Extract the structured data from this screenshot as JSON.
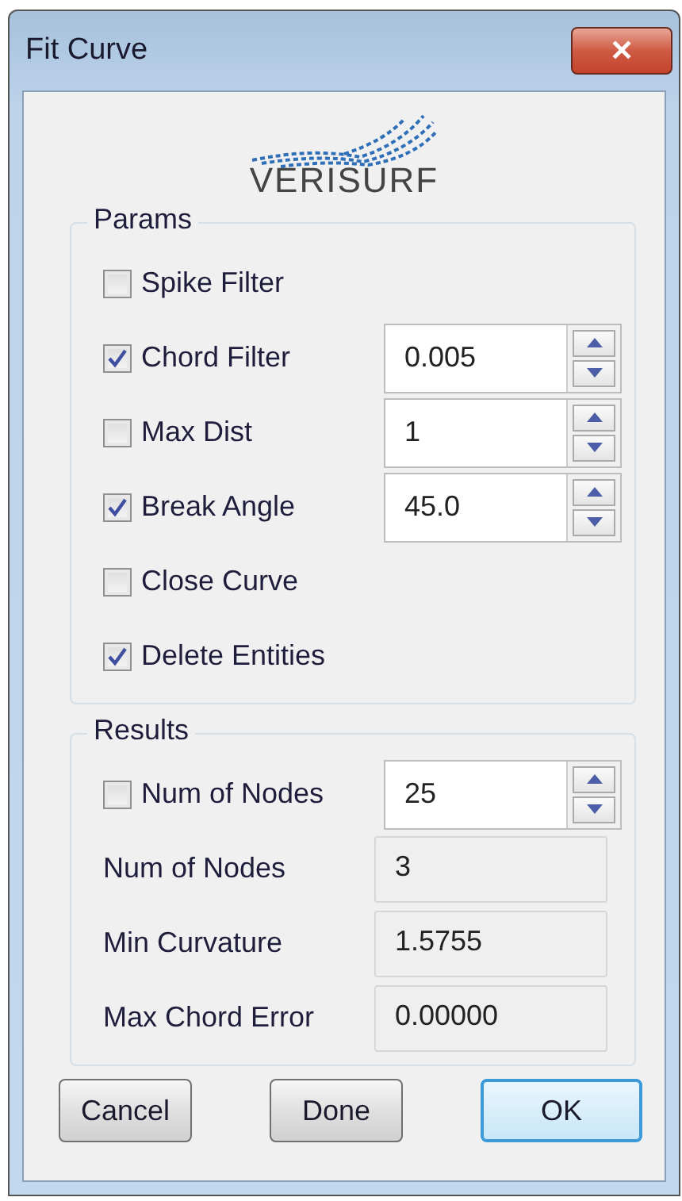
{
  "window": {
    "title": "Fit Curve",
    "close": "✕"
  },
  "logo": {
    "text": "VERISURF"
  },
  "params": {
    "title": "Params",
    "rows": [
      {
        "kind": "check",
        "label": "Spike Filter",
        "checked": false
      },
      {
        "kind": "spin",
        "label": "Chord Filter",
        "checked": true,
        "value": "0.005"
      },
      {
        "kind": "spin",
        "label": "Max Dist",
        "checked": false,
        "value": "1"
      },
      {
        "kind": "spin",
        "label": "Break Angle",
        "checked": true,
        "value": "45.0"
      },
      {
        "kind": "check",
        "label": "Close Curve",
        "checked": false
      },
      {
        "kind": "check",
        "label": "Delete Entities",
        "checked": true
      }
    ]
  },
  "results": {
    "title": "Results",
    "rows": [
      {
        "kind": "spin",
        "label": "Num of Nodes",
        "checked": false,
        "value": "25"
      },
      {
        "kind": "readout",
        "label": "Num of Nodes",
        "value": "3"
      },
      {
        "kind": "readout",
        "label": "Min Curvature",
        "value": "1.5755"
      },
      {
        "kind": "readout",
        "label": "Max Chord Error",
        "value": "0.00000"
      }
    ]
  },
  "buttons": [
    {
      "label": "Cancel",
      "default": false
    },
    {
      "label": "Done",
      "default": false
    },
    {
      "label": "OK",
      "default": true
    }
  ]
}
